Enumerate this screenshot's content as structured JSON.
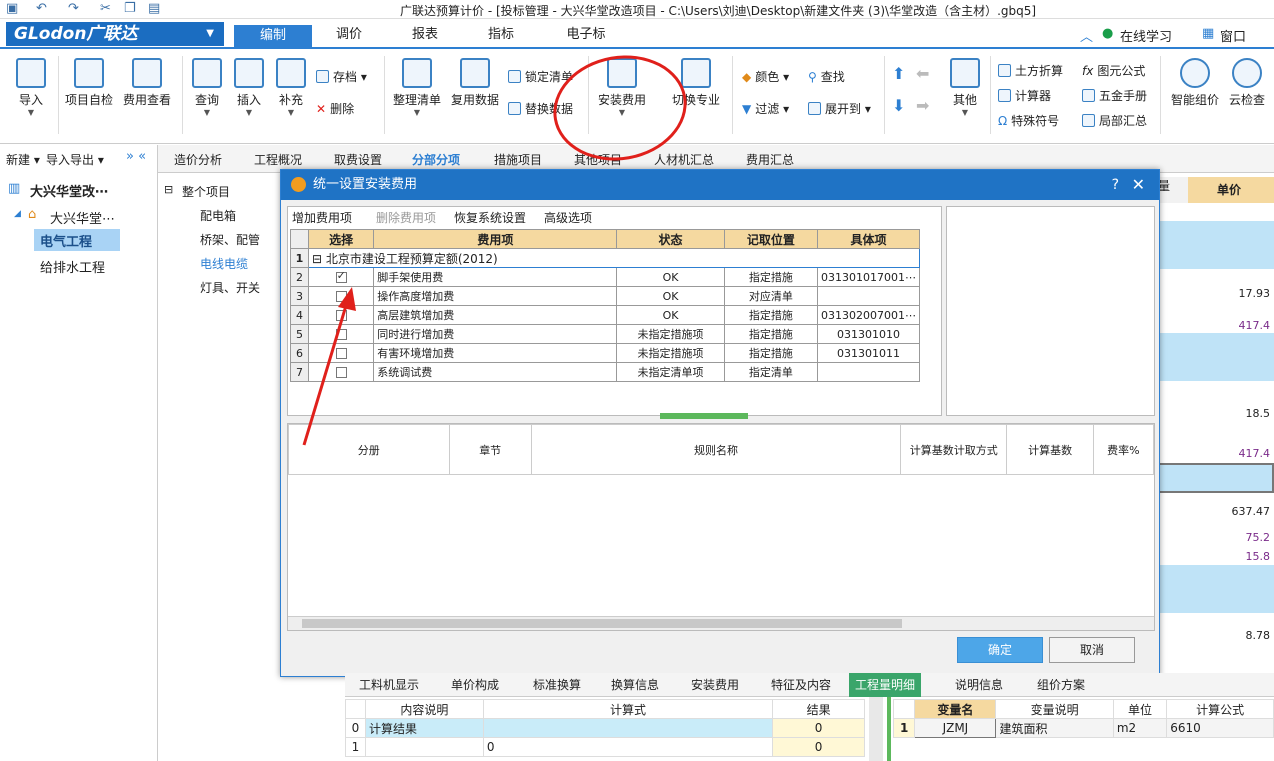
{
  "window": {
    "title": "广联达预算计价 - [投标管理 - 大兴华堂改造项目 - C:\\Users\\刘迪\\Desktop\\新建文件夹 (3)\\华堂改造（含主材）.gbq5]"
  },
  "app": {
    "logo": "GLodon广联达"
  },
  "menu": {
    "tabs": [
      "编制",
      "调价",
      "报表",
      "指标",
      "电子标"
    ],
    "online_learning": "在线学习",
    "window": "窗口"
  },
  "ribbon": {
    "import": "导入",
    "self_check": "项目自检",
    "fee_view": "费用查看",
    "query": "查询",
    "insert": "插入",
    "supplement": "补充",
    "save": "存档",
    "delete": "删除",
    "organize": "整理清单",
    "reuse": "复用数据",
    "lock": "锁定清单",
    "replace": "替换数据",
    "install_fee": "安装费用",
    "switch": "切换专业",
    "color": "颜色",
    "filter": "过滤",
    "find": "查找",
    "expand": "展开到",
    "other": "其他",
    "earthwork": "土方折算",
    "calculator": "计算器",
    "special_char": "特殊符号",
    "element_formula": "图元公式",
    "hardware": "五金手册",
    "partial_sum": "局部汇总",
    "smart_price": "智能组价",
    "cloud_check": "云检查"
  },
  "left": {
    "new": "新建",
    "import_export": "导入导出",
    "project": "大兴华堂改⋯",
    "subproject": "大兴华堂⋯",
    "items": [
      "电气工程",
      "给排水工程"
    ]
  },
  "subtabs": [
    "造价分析",
    "工程概况",
    "取费设置",
    "分部分项",
    "措施项目",
    "其他项目",
    "人材机汇总",
    "费用汇总"
  ],
  "projtree": {
    "root": "整个项目",
    "items": [
      "配电箱",
      "桥架、配管",
      "电线电缆",
      "灯具、开关"
    ]
  },
  "rightgrid": {
    "header": "单价",
    "header_prev": "量",
    "values": [
      "17.93",
      "417.4",
      "18.5",
      "417.4",
      "637.47",
      "75.2",
      "15.8",
      "8.78"
    ]
  },
  "dialog": {
    "title": "统一设置安装费用",
    "help": "?",
    "close": "✕",
    "toolbar": {
      "add": "增加费用项",
      "remove": "删除费用项",
      "restore": "恢复系统设置",
      "advanced": "高级选项"
    },
    "columns": [
      "选择",
      "费用项",
      "状态",
      "记取位置",
      "具体项"
    ],
    "group": "北京市建设工程预算定额(2012)",
    "rows": [
      {
        "n": "2",
        "checked": true,
        "name": "脚手架使用费",
        "status": "OK",
        "pos": "指定措施",
        "item": "031301017001⋯"
      },
      {
        "n": "3",
        "checked": false,
        "name": "操作高度增加费",
        "status": "OK",
        "pos": "对应清单",
        "item": ""
      },
      {
        "n": "4",
        "checked": false,
        "name": "高层建筑增加费",
        "status": "OK",
        "pos": "指定措施",
        "item": "031302007001⋯"
      },
      {
        "n": "5",
        "checked": false,
        "name": "同时进行增加费",
        "status": "未指定措施项",
        "pos": "指定措施",
        "item": "031301010"
      },
      {
        "n": "6",
        "checked": false,
        "name": "有害环境增加费",
        "status": "未指定措施项",
        "pos": "指定措施",
        "item": "031301011"
      },
      {
        "n": "7",
        "checked": false,
        "name": "系统调试费",
        "status": "未指定清单项",
        "pos": "指定清单",
        "item": ""
      }
    ],
    "bottom_columns": [
      "分册",
      "章节",
      "规则名称",
      "计算基数计取方式",
      "计算基数",
      "费率%"
    ],
    "ok": "确定",
    "cancel": "取消"
  },
  "bottomtabs": [
    "工料机显示",
    "单价构成",
    "标准换算",
    "换算信息",
    "安装费用",
    "特征及内容",
    "工程量明细",
    "说明信息",
    "组价方案"
  ],
  "bottomgrid": {
    "cols": [
      "内容说明",
      "计算式",
      "结果"
    ],
    "rows": [
      {
        "n": "0",
        "desc": "计算结果",
        "calc": "",
        "res": "0"
      },
      {
        "n": "1",
        "desc": "",
        "calc": "0",
        "res": "0"
      }
    ],
    "var_cols": [
      "变量名",
      "变量说明",
      "单位",
      "计算公式"
    ],
    "var_row": {
      "n": "1",
      "name": "JZMJ",
      "desc": "建筑面积",
      "unit": "m2",
      "formula": "6610"
    }
  },
  "colors": {
    "accent": "#2d7fd2",
    "annotation": "#e0201b"
  }
}
